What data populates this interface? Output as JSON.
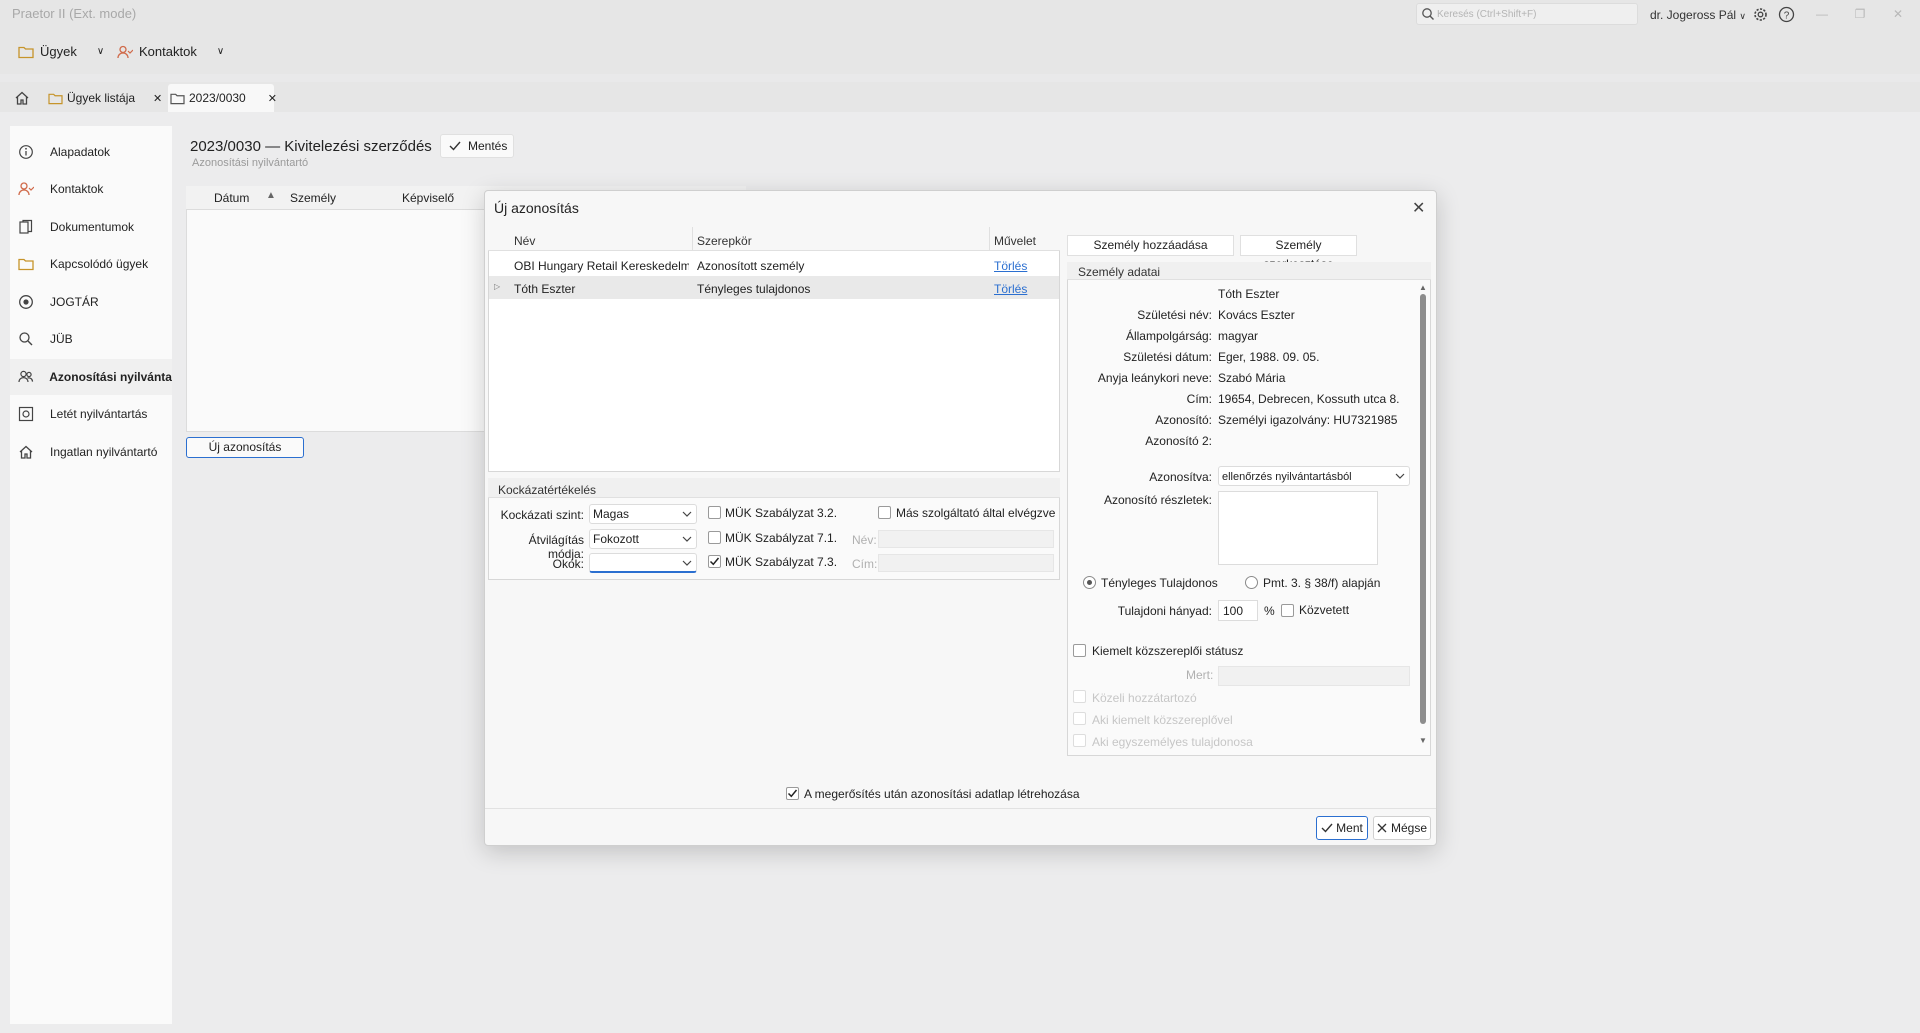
{
  "app": {
    "title": "Praetor II (Ext. mode)",
    "search_placeholder": "Keresés (Ctrl+Shift+F)",
    "user_name": "dr. Jogeross Pál"
  },
  "menu": {
    "cases_label": "Ügyek",
    "contacts_label": "Kontaktok"
  },
  "tabs": [
    {
      "label": "Ügyek listája"
    },
    {
      "label": "2023/0030"
    }
  ],
  "sidebar": {
    "items": [
      {
        "label": "Alapadatok",
        "icon": "info-icon"
      },
      {
        "label": "Kontaktok",
        "icon": "contacts-icon"
      },
      {
        "label": "Dokumentumok",
        "icon": "documents-icon"
      },
      {
        "label": "Kapcsolódó ügyek",
        "icon": "folder-icon"
      },
      {
        "label": "JOGTÁR",
        "icon": "jogtar-icon"
      },
      {
        "label": "JÜB",
        "icon": "search-icon"
      },
      {
        "label": "Azonosítási nyilvántartó",
        "icon": "people-icon",
        "active": true
      },
      {
        "label": "Letét nyilvántartás",
        "icon": "safe-icon"
      },
      {
        "label": "Ingatlan nyilvántartó",
        "icon": "home-icon"
      }
    ]
  },
  "page": {
    "title": "2023/0030 — Kivitelezési szerződés",
    "subtitle": "Azonosítási nyilvántartó",
    "save_label": "Mentés",
    "table_headers": [
      "Dátum",
      "Személy",
      "Képviselő"
    ],
    "new_button": "Új azonosítás"
  },
  "dialog": {
    "title": "Új azonosítás",
    "persons_headers": [
      "Név",
      "Szerepkör",
      "Művelet"
    ],
    "persons": [
      {
        "name": "OBI Hungary Retail Kereskedelmi...",
        "role": "Azonosított személy",
        "action": "Törlés"
      },
      {
        "name": "Tóth Eszter",
        "role": "Tényleges tulajdonos",
        "action": "Törlés"
      }
    ],
    "risk": {
      "title": "Kockázatértékelés",
      "level_label": "Kockázati szint:",
      "level_value": "Magas",
      "transparency_label": "Átvilágítás módja:",
      "transparency_value": "Fokozott",
      "reasons_label": "Okok:",
      "reasons_value": "",
      "muk1": "MÜK Szabályzat 3.2.",
      "muk2": "MÜK Szabályzat 7.1.",
      "muk3": "MÜK Szabályzat 7.3.",
      "other_provider": "Más szolgáltató által elvégzve",
      "name_label": "Név:",
      "address_label": "Cím:"
    },
    "add_person": "Személy hozzáadása",
    "edit_person": "Személy szerkesztése",
    "person_panel": {
      "title": "Személy adatai",
      "name": "Tóth Eszter",
      "fields": [
        {
          "label": "Születési név:",
          "value": "Kovács Eszter"
        },
        {
          "label": "Állampolgárság:",
          "value": "magyar"
        },
        {
          "label": "Születési dátum:",
          "value": "Eger, 1988. 09. 05."
        },
        {
          "label": "Anyja leánykori neve:",
          "value": "Szabó Mária"
        },
        {
          "label": "Cím:",
          "value": "19654, Debrecen, Kossuth utca 8."
        },
        {
          "label": "Azonosító:",
          "value": "Személyi igazolvány: HU7321985"
        },
        {
          "label": "Azonosító 2:",
          "value": ""
        }
      ],
      "identified_label": "Azonosítva:",
      "identified_value": "ellenőrzés nyilvántartásból",
      "details_label": "Azonosító részletek:",
      "radio_owner": "Tényleges Tulajdonos",
      "radio_pmt": "Pmt. 3. § 38/f) alapján",
      "share_label": "Tulajdoni hányad:",
      "share_value": "100",
      "share_unit": "%",
      "indirect": "Közvetett",
      "pep_status": "Kiemelt közszereplői státusz",
      "because_label": "Mert:",
      "close_relative": "Közeli hozzátartozó",
      "with_pep": "Aki kiemelt közszereplővel",
      "sole_owner": "Aki egyszemélyes tulajdonosa"
    },
    "confirm_checkbox": "A megerősítés után azonosítási adatlap létrehozása",
    "ok_label": "Ment",
    "cancel_label": "Mégse"
  }
}
